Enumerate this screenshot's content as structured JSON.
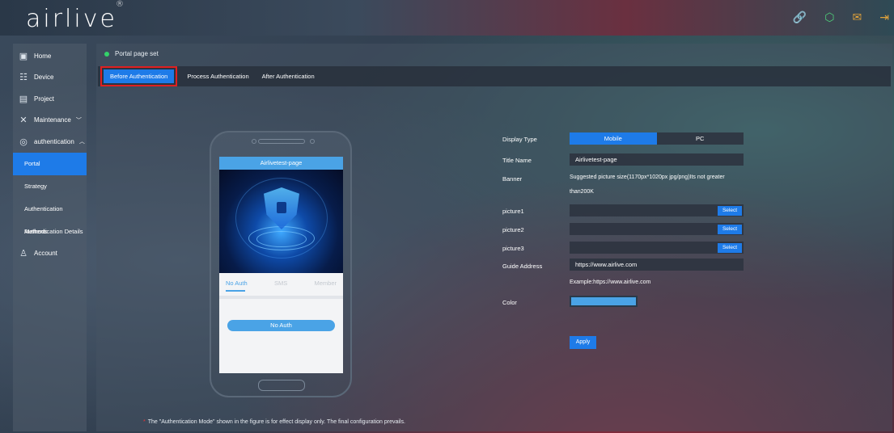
{
  "header": {
    "logo": "airlive",
    "icons": [
      "link-icon",
      "network-icon",
      "mail-icon",
      "logout-icon"
    ]
  },
  "sidebar": {
    "items": [
      {
        "label": "Home",
        "icon": "monitor-icon"
      },
      {
        "label": "Device",
        "icon": "device-list-icon"
      },
      {
        "label": "Project",
        "icon": "project-icon"
      },
      {
        "label": "Maintenance",
        "icon": "tools-icon",
        "chevron": "down"
      },
      {
        "label": "authentication",
        "icon": "shield-check-icon",
        "chevron": "up"
      }
    ],
    "subitems": [
      {
        "label": "Portal",
        "active": true
      },
      {
        "label": "Strategy"
      },
      {
        "label": "Authentication Methods"
      },
      {
        "label": "Authentication Details"
      }
    ],
    "account": {
      "label": "Account",
      "icon": "user-icon"
    }
  },
  "main": {
    "breadcrumb": "Portal page set",
    "tabs": [
      {
        "label": "Before Authentication",
        "active": true
      },
      {
        "label": "Process Authentication"
      },
      {
        "label": "After Authentication"
      }
    ],
    "footnote": "The \"Authentication Mode\" shown in the figure is for effect display only. The final configuration prevails."
  },
  "phone_preview": {
    "title": "Airlivetest-page",
    "auth_tabs": [
      "No Auth",
      "SMS",
      "Member"
    ],
    "button": "No Auth"
  },
  "form": {
    "display_type": {
      "label": "Display Type",
      "options": [
        "Mobile",
        "PC"
      ],
      "selected": "Mobile"
    },
    "title_name": {
      "label": "Title Name",
      "value": "Airlivetest-page"
    },
    "banner": {
      "label": "Banner",
      "hint_line1": "Suggested picture size(1170px*1020px jpg/png)Its not greater",
      "hint_line2": "than200K"
    },
    "pictures": [
      {
        "label": "picture1",
        "button": "Select"
      },
      {
        "label": "picture2",
        "button": "Select"
      },
      {
        "label": "picture3",
        "button": "Select"
      }
    ],
    "guide_address": {
      "label": "Guide Address",
      "value": "https://www.airlive.com",
      "example": "Example:https://www.airlive.com"
    },
    "color": {
      "label": "Color",
      "value": "#4aa3e6"
    },
    "apply": "Apply"
  },
  "colors": {
    "accent": "#1e7be8",
    "phone_accent": "#4aa3e6",
    "status_dot": "#33d36a",
    "highlight_box": "#e02020"
  }
}
